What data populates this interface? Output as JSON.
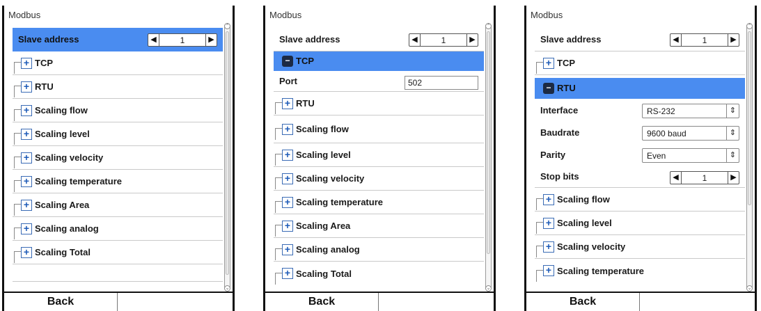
{
  "panels": [
    {
      "title": "Modbus",
      "slave_address": {
        "label": "Slave address",
        "value": "1"
      },
      "tcp_label": "TCP",
      "rtu_label": "RTU",
      "groups": [
        "Scaling flow",
        "Scaling level",
        "Scaling velocity",
        "Scaling temperature",
        "Scaling Area",
        "Scaling analog",
        "Scaling Total"
      ],
      "back": "Back"
    },
    {
      "title": "Modbus",
      "slave_address": {
        "label": "Slave address",
        "value": "1"
      },
      "tcp_label": "TCP",
      "port": {
        "label": "Port",
        "value": "502"
      },
      "rtu_label": "RTU",
      "groups": [
        "Scaling flow",
        "Scaling level",
        "Scaling velocity",
        "Scaling temperature",
        "Scaling Area",
        "Scaling analog",
        "Scaling Total"
      ],
      "back": "Back"
    },
    {
      "title": "Modbus",
      "slave_address": {
        "label": "Slave address",
        "value": "1"
      },
      "tcp_label": "TCP",
      "rtu_label": "RTU",
      "interface": {
        "label": "Interface",
        "value": "RS-232"
      },
      "baudrate": {
        "label": "Baudrate",
        "value": "9600 baud"
      },
      "parity": {
        "label": "Parity",
        "value": "Even"
      },
      "stop_bits": {
        "label": "Stop bits",
        "value": "1"
      },
      "groups": [
        "Scaling flow",
        "Scaling level",
        "Scaling velocity",
        "Scaling temperature"
      ],
      "back": "Back"
    }
  ],
  "icons": {
    "expand": "plus-icon",
    "collapse": "minus-icon",
    "left": "arrow-left-icon",
    "right": "arrow-right-icon",
    "updown": "updown-icon"
  },
  "colors": {
    "selection": "#4a8cf0",
    "expander": "#1e5bb8"
  }
}
